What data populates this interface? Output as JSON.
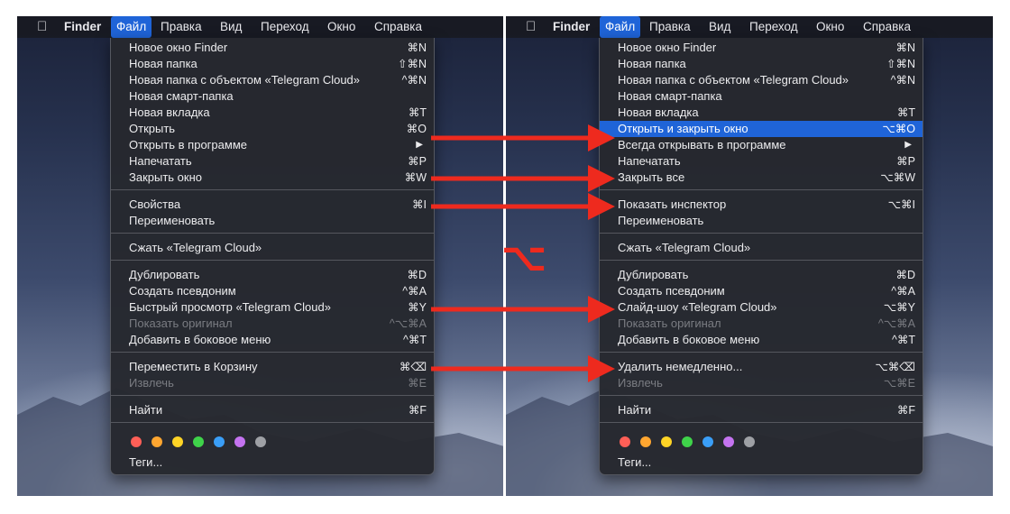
{
  "left": {
    "menubar": {
      "apple_icon": "apple-logo",
      "items": [
        {
          "label": "Finder"
        },
        {
          "label": "Файл"
        },
        {
          "label": "Правка"
        },
        {
          "label": "Вид"
        },
        {
          "label": "Переход"
        },
        {
          "label": "Окно"
        },
        {
          "label": "Справка"
        }
      ]
    },
    "menu": {
      "items": [
        {
          "label": "Новое окно Finder",
          "shortcut": "⌘N"
        },
        {
          "label": "Новая папка",
          "shortcut": "⇧⌘N"
        },
        {
          "label": "Новая папка с объектом «Telegram Cloud»",
          "shortcut": "^⌘N"
        },
        {
          "label": "Новая смарт-папка",
          "shortcut": ""
        },
        {
          "label": "Новая вкладка",
          "shortcut": "⌘T"
        },
        {
          "label": "Открыть",
          "shortcut": "⌘O"
        },
        {
          "label": "Открыть в программе",
          "shortcut": "▶"
        },
        {
          "label": "Напечатать",
          "shortcut": "⌘P"
        },
        {
          "label": "Закрыть окно",
          "shortcut": "⌘W"
        },
        {
          "label": "Свойства",
          "shortcut": "⌘I"
        },
        {
          "label": "Переименовать",
          "shortcut": ""
        },
        {
          "label": "Сжать «Telegram Cloud»",
          "shortcut": ""
        },
        {
          "label": "Дублировать",
          "shortcut": "⌘D"
        },
        {
          "label": "Создать псевдоним",
          "shortcut": "^⌘A"
        },
        {
          "label": "Быстрый просмотр «Telegram Cloud»",
          "shortcut": "⌘Y"
        },
        {
          "label": "Показать оригинал",
          "shortcut": "^⌥⌘A"
        },
        {
          "label": "Добавить в боковое меню",
          "shortcut": "^⌘T"
        },
        {
          "label": "Переместить в Корзину",
          "shortcut": "⌘⌫"
        },
        {
          "label": "Извлечь",
          "shortcut": "⌘E"
        },
        {
          "label": "Найти",
          "shortcut": "⌘F"
        },
        {
          "label": "Теги...",
          "shortcut": ""
        }
      ],
      "tag_colors": [
        "#ff5f57",
        "#ffa630",
        "#ffd426",
        "#3fd34a",
        "#3a9ef7",
        "#c473f0",
        "#9ea0a5"
      ]
    }
  },
  "right": {
    "menubar": {
      "apple_icon": "apple-logo",
      "items": [
        {
          "label": "Finder"
        },
        {
          "label": "Файл"
        },
        {
          "label": "Правка"
        },
        {
          "label": "Вид"
        },
        {
          "label": "Переход"
        },
        {
          "label": "Окно"
        },
        {
          "label": "Справка"
        }
      ]
    },
    "menu": {
      "items": [
        {
          "label": "Новое окно Finder",
          "shortcut": "⌘N"
        },
        {
          "label": "Новая папка",
          "shortcut": "⇧⌘N"
        },
        {
          "label": "Новая папка с объектом «Telegram Cloud»",
          "shortcut": "^⌘N"
        },
        {
          "label": "Новая смарт-папка",
          "shortcut": ""
        },
        {
          "label": "Новая вкладка",
          "shortcut": "⌘T"
        },
        {
          "label": "Открыть и закрыть окно",
          "shortcut": "⌥⌘O"
        },
        {
          "label": "Всегда открывать в программе",
          "shortcut": "▶"
        },
        {
          "label": "Напечатать",
          "shortcut": "⌘P"
        },
        {
          "label": "Закрыть все",
          "shortcut": "⌥⌘W"
        },
        {
          "label": "Показать инспектор",
          "shortcut": "⌥⌘I"
        },
        {
          "label": "Переименовать",
          "shortcut": ""
        },
        {
          "label": "Сжать «Telegram Cloud»",
          "shortcut": ""
        },
        {
          "label": "Дублировать",
          "shortcut": "⌘D"
        },
        {
          "label": "Создать псевдоним",
          "shortcut": "^⌘A"
        },
        {
          "label": "Слайд-шоу «Telegram Cloud»",
          "shortcut": "⌥⌘Y"
        },
        {
          "label": "Показать оригинал",
          "shortcut": "^⌥⌘A"
        },
        {
          "label": "Добавить в боковое меню",
          "shortcut": "^⌘T"
        },
        {
          "label": "Удалить немедленно...",
          "shortcut": "⌥⌘⌫"
        },
        {
          "label": "Извлечь",
          "shortcut": "⌥⌘E"
        },
        {
          "label": "Найти",
          "shortcut": "⌘F"
        },
        {
          "label": "Теги...",
          "shortcut": ""
        }
      ],
      "tag_colors": [
        "#ff5f57",
        "#ffa630",
        "#ffd426",
        "#3fd34a",
        "#3a9ef7",
        "#c473f0",
        "#9ea0a5"
      ]
    }
  },
  "annotation": {
    "option_symbol": "⌥",
    "arrow_color": "#ee2a1e"
  }
}
